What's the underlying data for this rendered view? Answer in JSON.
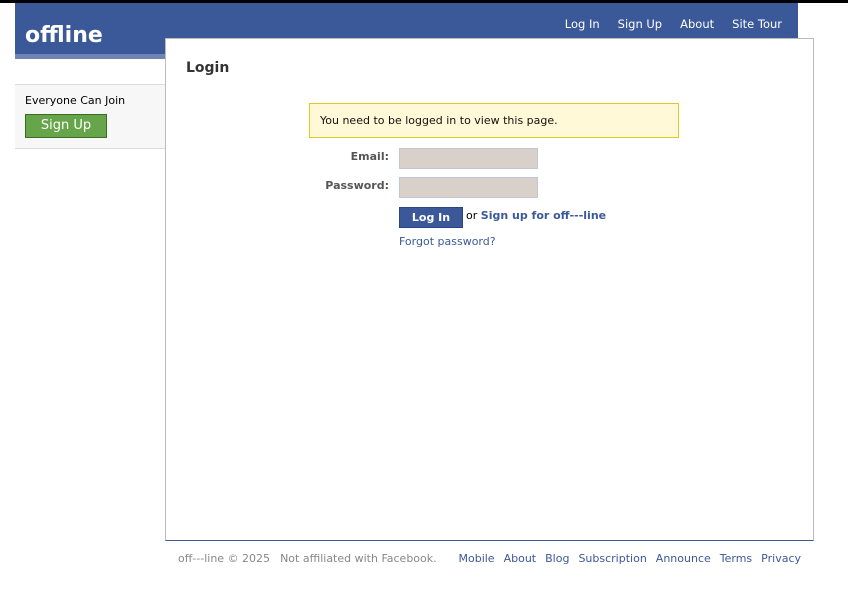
{
  "header": {
    "logo": "offline",
    "nav": [
      "Log In",
      "Sign Up",
      "About",
      "Site Tour"
    ]
  },
  "sidebar": {
    "text": "Everyone Can Join",
    "signup": "Sign Up"
  },
  "main": {
    "title": "Login",
    "message": "You need to be logged in to view this page.",
    "email_label": "Email:",
    "email_value": "",
    "password_label": "Password:",
    "password_value": "",
    "login_button": "Log In",
    "or": "or",
    "signup_link": "Sign up for off---line",
    "forgot": "Forgot password?"
  },
  "footer": {
    "copyright": "off---line © 2025",
    "disclaimer": "Not affiliated with Facebook.",
    "links": [
      "Mobile",
      "About",
      "Blog",
      "Subscription",
      "Announce",
      "Terms",
      "Privacy"
    ]
  }
}
